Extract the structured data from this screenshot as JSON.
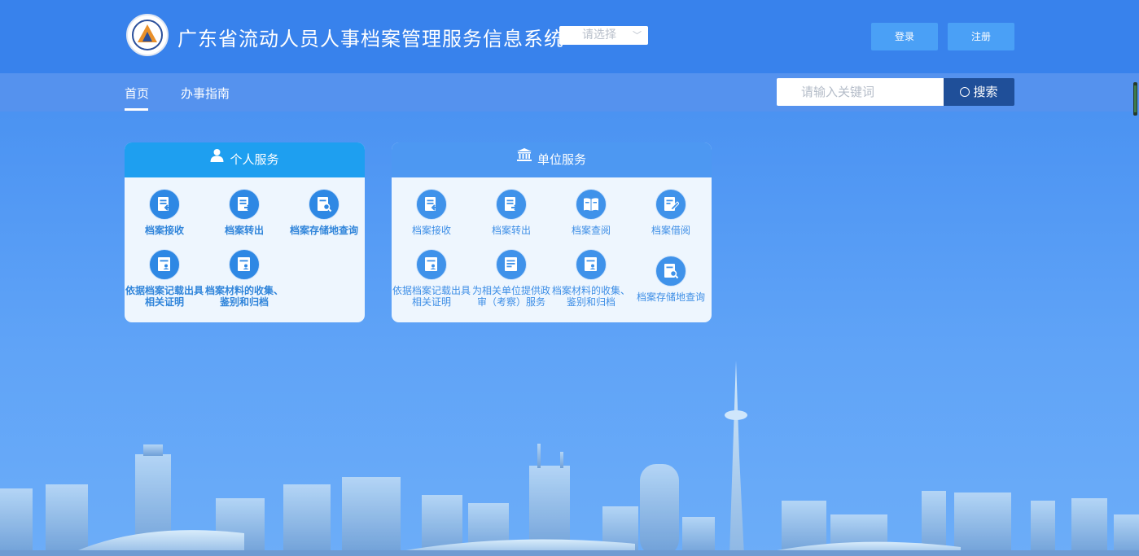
{
  "header": {
    "title": "广东省流动人员人事档案管理服务信息系统",
    "logo_icon": "emblem-logo-icon",
    "region_select": {
      "value": "请选择"
    },
    "login_label": "登录",
    "register_label": "注册"
  },
  "nav": {
    "items": [
      {
        "label": "首页",
        "active": true
      },
      {
        "label": "办事指南",
        "active": false
      }
    ],
    "search": {
      "placeholder": "请输入关键词",
      "button_label": "搜索"
    }
  },
  "personal_panel": {
    "title": "个人服务",
    "icon": "user-icon",
    "items": [
      {
        "label": "档案接收",
        "icon": "document-in-icon"
      },
      {
        "label": "档案转出",
        "icon": "document-out-icon"
      },
      {
        "label": "档案存储地查询",
        "icon": "document-search-icon"
      },
      {
        "label1": "依据档案记载出具",
        "label2": "相关证明",
        "icon": "certificate-icon"
      },
      {
        "label1": "档案材料的收集、",
        "label2": "鉴别和归档",
        "icon": "archive-icon"
      }
    ]
  },
  "unit_panel": {
    "title": "单位服务",
    "icon": "bank-icon",
    "items": [
      {
        "label": "档案接收",
        "icon": "document-in-icon"
      },
      {
        "label": "档案转出",
        "icon": "document-out-icon"
      },
      {
        "label": "档案查阅",
        "icon": "book-open-icon"
      },
      {
        "label": "档案借阅",
        "icon": "document-edit-icon"
      },
      {
        "label1": "依据档案记载出具",
        "label2": "相关证明",
        "icon": "certificate-icon"
      },
      {
        "label1": "为相关单位提供政",
        "label2": "审（考察）服务",
        "icon": "review-icon"
      },
      {
        "label1": "档案材料的收集、",
        "label2": "鉴别和归档",
        "icon": "archive-icon"
      },
      {
        "label": "档案存储地查询",
        "icon": "document-search-icon"
      }
    ]
  },
  "colors": {
    "topbar": "#3882ec",
    "navbar": "#5592ee",
    "search_button": "#1f4f99",
    "personal_header": "#1e9ff0",
    "unit_header": "#4d98f2",
    "icon_circle": "#2e88e4"
  }
}
